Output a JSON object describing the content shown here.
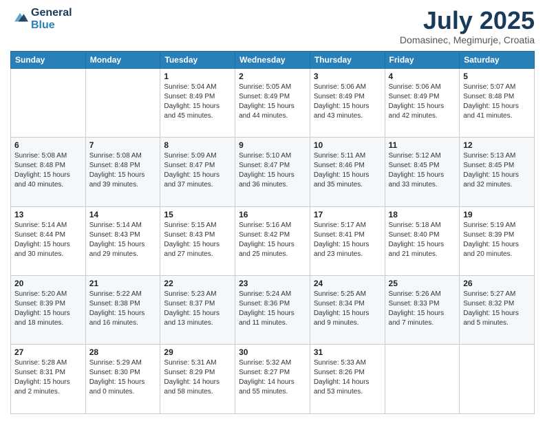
{
  "header": {
    "logo_general": "General",
    "logo_blue": "Blue",
    "month": "July 2025",
    "location": "Domasinec, Megimurje, Croatia"
  },
  "weekdays": [
    "Sunday",
    "Monday",
    "Tuesday",
    "Wednesday",
    "Thursday",
    "Friday",
    "Saturday"
  ],
  "weeks": [
    [
      {
        "day": "",
        "info": ""
      },
      {
        "day": "",
        "info": ""
      },
      {
        "day": "1",
        "info": "Sunrise: 5:04 AM\nSunset: 8:49 PM\nDaylight: 15 hours and 45 minutes."
      },
      {
        "day": "2",
        "info": "Sunrise: 5:05 AM\nSunset: 8:49 PM\nDaylight: 15 hours and 44 minutes."
      },
      {
        "day": "3",
        "info": "Sunrise: 5:06 AM\nSunset: 8:49 PM\nDaylight: 15 hours and 43 minutes."
      },
      {
        "day": "4",
        "info": "Sunrise: 5:06 AM\nSunset: 8:49 PM\nDaylight: 15 hours and 42 minutes."
      },
      {
        "day": "5",
        "info": "Sunrise: 5:07 AM\nSunset: 8:48 PM\nDaylight: 15 hours and 41 minutes."
      }
    ],
    [
      {
        "day": "6",
        "info": "Sunrise: 5:08 AM\nSunset: 8:48 PM\nDaylight: 15 hours and 40 minutes."
      },
      {
        "day": "7",
        "info": "Sunrise: 5:08 AM\nSunset: 8:48 PM\nDaylight: 15 hours and 39 minutes."
      },
      {
        "day": "8",
        "info": "Sunrise: 5:09 AM\nSunset: 8:47 PM\nDaylight: 15 hours and 37 minutes."
      },
      {
        "day": "9",
        "info": "Sunrise: 5:10 AM\nSunset: 8:47 PM\nDaylight: 15 hours and 36 minutes."
      },
      {
        "day": "10",
        "info": "Sunrise: 5:11 AM\nSunset: 8:46 PM\nDaylight: 15 hours and 35 minutes."
      },
      {
        "day": "11",
        "info": "Sunrise: 5:12 AM\nSunset: 8:45 PM\nDaylight: 15 hours and 33 minutes."
      },
      {
        "day": "12",
        "info": "Sunrise: 5:13 AM\nSunset: 8:45 PM\nDaylight: 15 hours and 32 minutes."
      }
    ],
    [
      {
        "day": "13",
        "info": "Sunrise: 5:14 AM\nSunset: 8:44 PM\nDaylight: 15 hours and 30 minutes."
      },
      {
        "day": "14",
        "info": "Sunrise: 5:14 AM\nSunset: 8:43 PM\nDaylight: 15 hours and 29 minutes."
      },
      {
        "day": "15",
        "info": "Sunrise: 5:15 AM\nSunset: 8:43 PM\nDaylight: 15 hours and 27 minutes."
      },
      {
        "day": "16",
        "info": "Sunrise: 5:16 AM\nSunset: 8:42 PM\nDaylight: 15 hours and 25 minutes."
      },
      {
        "day": "17",
        "info": "Sunrise: 5:17 AM\nSunset: 8:41 PM\nDaylight: 15 hours and 23 minutes."
      },
      {
        "day": "18",
        "info": "Sunrise: 5:18 AM\nSunset: 8:40 PM\nDaylight: 15 hours and 21 minutes."
      },
      {
        "day": "19",
        "info": "Sunrise: 5:19 AM\nSunset: 8:39 PM\nDaylight: 15 hours and 20 minutes."
      }
    ],
    [
      {
        "day": "20",
        "info": "Sunrise: 5:20 AM\nSunset: 8:39 PM\nDaylight: 15 hours and 18 minutes."
      },
      {
        "day": "21",
        "info": "Sunrise: 5:22 AM\nSunset: 8:38 PM\nDaylight: 15 hours and 16 minutes."
      },
      {
        "day": "22",
        "info": "Sunrise: 5:23 AM\nSunset: 8:37 PM\nDaylight: 15 hours and 13 minutes."
      },
      {
        "day": "23",
        "info": "Sunrise: 5:24 AM\nSunset: 8:36 PM\nDaylight: 15 hours and 11 minutes."
      },
      {
        "day": "24",
        "info": "Sunrise: 5:25 AM\nSunset: 8:34 PM\nDaylight: 15 hours and 9 minutes."
      },
      {
        "day": "25",
        "info": "Sunrise: 5:26 AM\nSunset: 8:33 PM\nDaylight: 15 hours and 7 minutes."
      },
      {
        "day": "26",
        "info": "Sunrise: 5:27 AM\nSunset: 8:32 PM\nDaylight: 15 hours and 5 minutes."
      }
    ],
    [
      {
        "day": "27",
        "info": "Sunrise: 5:28 AM\nSunset: 8:31 PM\nDaylight: 15 hours and 2 minutes."
      },
      {
        "day": "28",
        "info": "Sunrise: 5:29 AM\nSunset: 8:30 PM\nDaylight: 15 hours and 0 minutes."
      },
      {
        "day": "29",
        "info": "Sunrise: 5:31 AM\nSunset: 8:29 PM\nDaylight: 14 hours and 58 minutes."
      },
      {
        "day": "30",
        "info": "Sunrise: 5:32 AM\nSunset: 8:27 PM\nDaylight: 14 hours and 55 minutes."
      },
      {
        "day": "31",
        "info": "Sunrise: 5:33 AM\nSunset: 8:26 PM\nDaylight: 14 hours and 53 minutes."
      },
      {
        "day": "",
        "info": ""
      },
      {
        "day": "",
        "info": ""
      }
    ]
  ]
}
